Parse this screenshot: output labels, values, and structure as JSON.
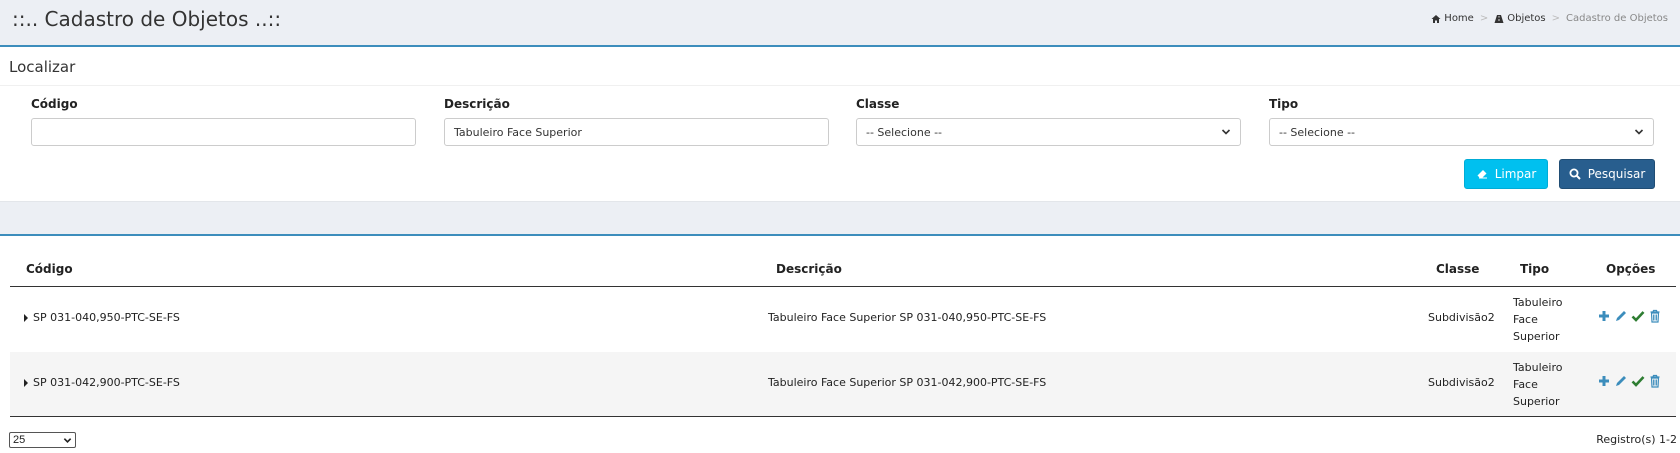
{
  "header": {
    "title": "::.. Cadastro de Objetos ..::",
    "breadcrumb": {
      "home": "Home",
      "objetos": "Objetos",
      "current": "Cadastro de Objetos"
    }
  },
  "search": {
    "heading": "Localizar",
    "codigo": {
      "label": "Código",
      "value": ""
    },
    "descricao": {
      "label": "Descrição",
      "value": "Tabuleiro Face Superior"
    },
    "classe": {
      "label": "Classe",
      "value": "-- Selecione --"
    },
    "tipo": {
      "label": "Tipo",
      "value": "-- Selecione --"
    },
    "clear_label": "Limpar",
    "search_label": "Pesquisar"
  },
  "table": {
    "headers": {
      "codigo": "Código",
      "descricao": "Descrição",
      "classe": "Classe",
      "tipo": "Tipo",
      "opcoes": "Opções"
    },
    "rows": [
      {
        "codigo": "SP 031-040,950-PTC-SE-FS",
        "descricao": "Tabuleiro Face Superior SP 031-040,950-PTC-SE-FS",
        "classe": "Subdivisão2",
        "tipo": [
          "Tabuleiro",
          "Face",
          "Superior"
        ]
      },
      {
        "codigo": "SP 031-042,900-PTC-SE-FS",
        "descricao": "Tabuleiro Face Superior SP 031-042,900-PTC-SE-FS",
        "classe": "Subdivisão2",
        "tipo": [
          "Tabuleiro",
          "Face",
          "Superior"
        ]
      }
    ]
  },
  "footer": {
    "page_size": "25",
    "records": "Registro(s) 1-2"
  },
  "colors": {
    "accent": "#3c8dbc",
    "info": "#00c0ef",
    "primary": "#285e8e",
    "success": "#2e7d32"
  },
  "icons": [
    "home-icon",
    "road-icon",
    "eraser-icon",
    "search-icon",
    "plus-icon",
    "pencil-icon",
    "check-icon",
    "trash-icon",
    "chevron-down-icon",
    "caret-right-icon"
  ]
}
